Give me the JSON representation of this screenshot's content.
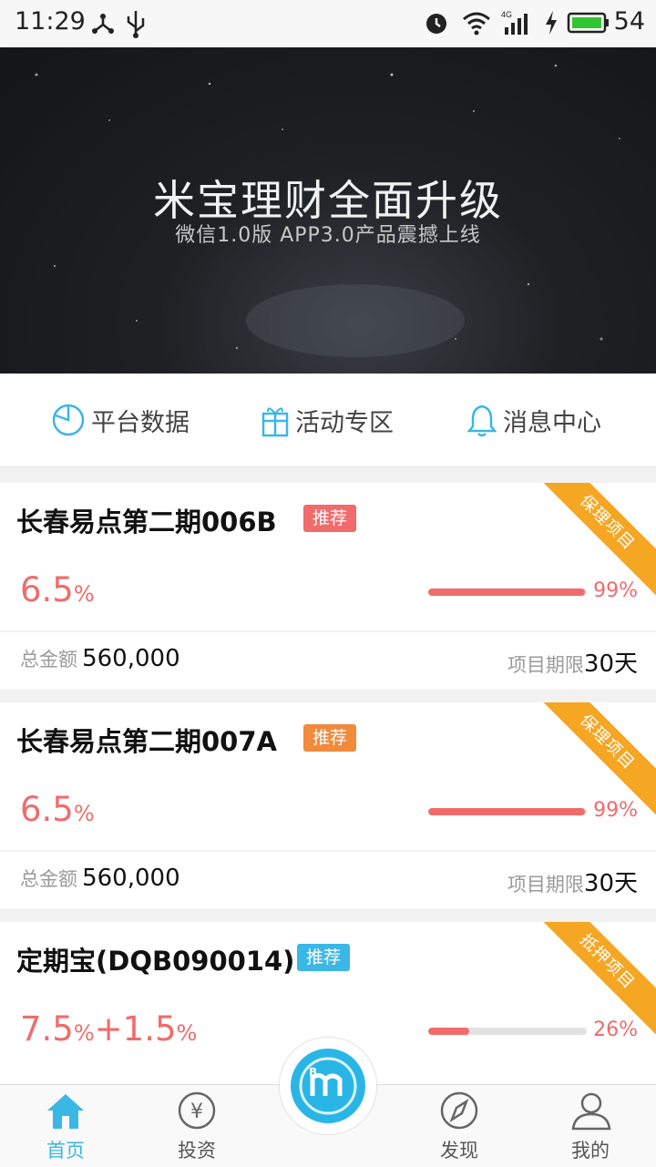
{
  "status_bar": {
    "time": "11:29",
    "battery": "54"
  },
  "banner": {
    "title": "米宝理财全面升级",
    "subtitle": "微信1.0版  APP3.0产品震撼上线"
  },
  "quick_nav": [
    {
      "label": "平台数据",
      "icon": "pie-chart-icon"
    },
    {
      "label": "活动专区",
      "icon": "gift-icon"
    },
    {
      "label": "消息中心",
      "icon": "bell-icon"
    }
  ],
  "products": [
    {
      "title": "长春易点第二期006B",
      "badge": "推荐",
      "badge_color": "#f06b6b",
      "rate": "6.5",
      "rate_unit": "%",
      "progress": 0.99,
      "progress_label": "99%",
      "amount_label": "总金额",
      "amount": "560,000",
      "term_label": "项目期限",
      "term": "30天",
      "ribbon": "保理项目"
    },
    {
      "title": "长春易点第二期007A",
      "badge": "推荐",
      "badge_color": "#f28a3c",
      "rate": "6.5",
      "rate_unit": "%",
      "progress": 0.99,
      "progress_label": "99%",
      "amount_label": "总金额",
      "amount": "560,000",
      "term_label": "项目期限",
      "term": "30天",
      "ribbon": "保理项目"
    },
    {
      "title": "定期宝(DQB090014)",
      "badge": "推荐",
      "badge_color": "#3bb7e6",
      "rate": "7.5",
      "rate_unit": "%",
      "rate_extra": "+1.5",
      "rate_extra_unit": "%",
      "progress": 0.26,
      "progress_label": "26%",
      "ribbon": "抵押项目"
    }
  ],
  "tab_bar": [
    {
      "label": "首页",
      "icon": "home-icon",
      "active": true
    },
    {
      "label": "投资",
      "icon": "yen-icon",
      "active": false
    },
    {
      "label": "发现",
      "icon": "compass-icon",
      "active": false
    },
    {
      "label": "我的",
      "icon": "user-icon",
      "active": false
    }
  ],
  "colors": {
    "accent": "#29b6e6",
    "rate": "#ef6c6b",
    "ribbon": "#f5a623"
  }
}
